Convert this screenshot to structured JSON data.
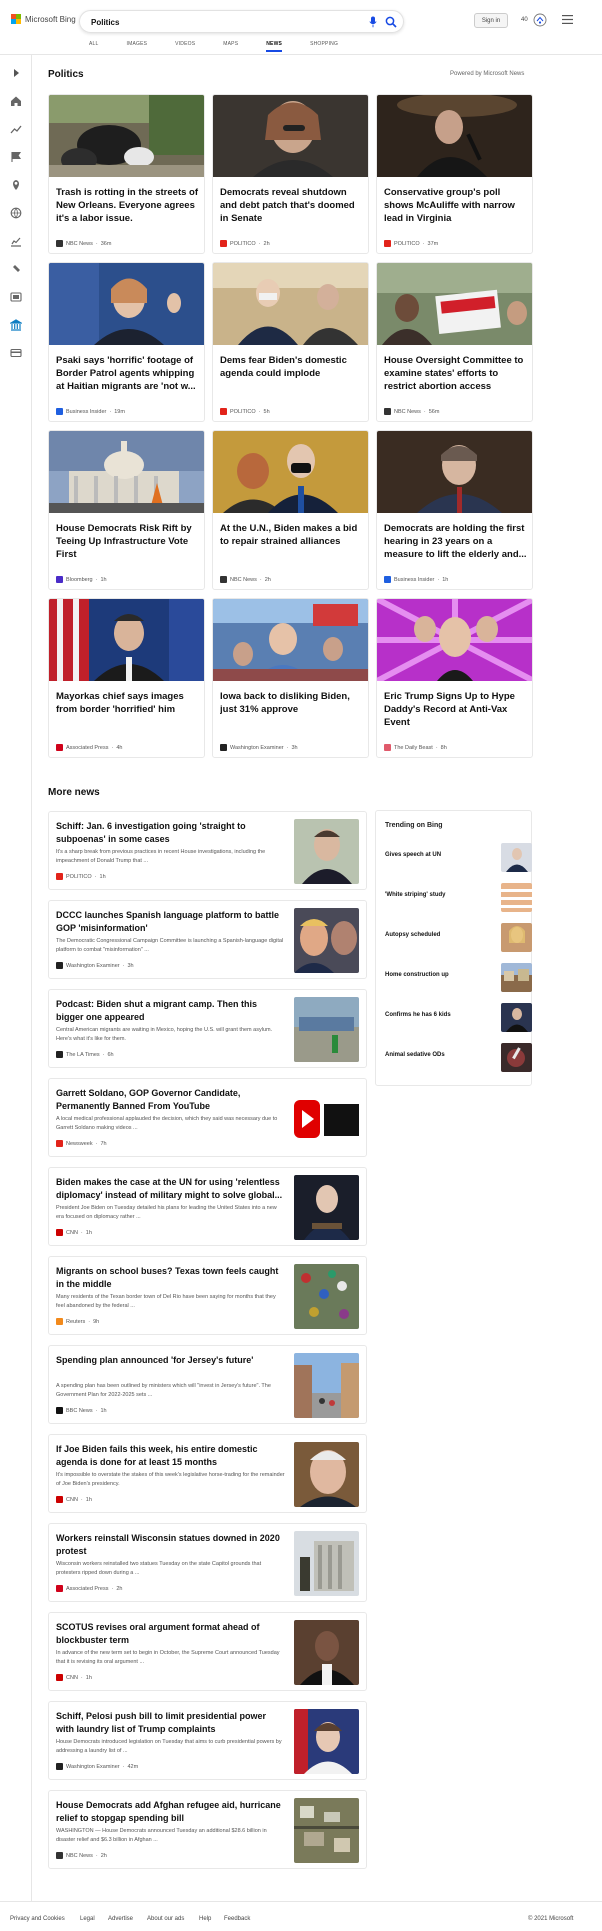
{
  "header": {
    "brand": "Microsoft Bing",
    "search_value": "Politics",
    "tabs": [
      {
        "label": "ALL"
      },
      {
        "label": "IMAGES"
      },
      {
        "label": "VIDEOS"
      },
      {
        "label": "MAPS"
      },
      {
        "label": "NEWS",
        "active": true
      },
      {
        "label": "SHOPPING"
      }
    ],
    "sign_in": "Sign in",
    "points": "40",
    "accent": "#174ae4"
  },
  "rail": {
    "icons": [
      "chevron-right-icon",
      "home-icon",
      "trending-icon",
      "flag-icon",
      "location-icon",
      "globe-icon",
      "finance-icon",
      "sports-icon",
      "entertainment-icon",
      "politics-icon",
      "technology-icon"
    ]
  },
  "politics": {
    "title": "Politics",
    "powered_by": "Powered by Microsoft News",
    "cards": [
      {
        "title": "Trash is rotting in the streets of New Orleans. Everyone agrees it's a labor issue.",
        "source": "NBC News",
        "time": "36m",
        "logo": "#333333"
      },
      {
        "title": "Democrats reveal shutdown and debt patch that's doomed in Senate",
        "source": "POLITICO",
        "time": "2h",
        "logo": "#e2231a"
      },
      {
        "title": "Conservative group's poll shows McAuliffe with narrow lead in Virginia",
        "source": "POLITICO",
        "time": "37m",
        "logo": "#e2231a"
      },
      {
        "title": "Psaki says 'horrific' footage of Border Patrol agents whipping at Haitian migrants are 'not w...",
        "source": "Business Insider",
        "time": "19m",
        "logo": "#1f5fe0"
      },
      {
        "title": "Dems fear Biden's domestic agenda could implode",
        "source": "POLITICO",
        "time": "5h",
        "logo": "#e2231a"
      },
      {
        "title": "House Oversight Committee to examine states' efforts to restrict abortion access",
        "source": "NBC News",
        "time": "56m",
        "logo": "#333333"
      },
      {
        "title": "House Democrats Risk Rift by Teeing Up Infrastructure Vote First",
        "source": "Bloomberg",
        "time": "1h",
        "logo": "#4a2cc8"
      },
      {
        "title": "At the U.N., Biden makes a bid to repair strained alliances",
        "source": "NBC News",
        "time": "2h",
        "logo": "#333333"
      },
      {
        "title": "Democrats are holding the first hearing in 23 years on a measure to lift the elderly and...",
        "source": "Business Insider",
        "time": "1h",
        "logo": "#1f5fe0"
      },
      {
        "title": "Mayorkas chief says images from border 'horrified' him",
        "source": "Associated Press",
        "time": "4h",
        "logo": "#d0021b"
      },
      {
        "title": "Iowa back to disliking Biden, just 31% approve",
        "source": "Washington Examiner",
        "time": "3h",
        "logo": "#222222"
      },
      {
        "title": "Eric Trump Signs Up to Hype Daddy's Record at Anti-Vax Event",
        "source": "The Daily Beast",
        "time": "8h",
        "logo": "#e05a6b"
      }
    ]
  },
  "more_news": {
    "title": "More news",
    "items": [
      {
        "title": "Schiff: Jan. 6 investigation going 'straight to subpoenas' in some cases",
        "snippet": "It's a sharp break from previous practices in recent House investigations, including the impeachment of Donald Trump that ...",
        "source": "POLITICO",
        "time": "1h",
        "logo": "#e2231a"
      },
      {
        "title": "DCCC launches Spanish language platform to battle GOP 'misinformation'",
        "snippet": "The Democratic Congressional Campaign Committee is launching a Spanish-language digital platform to combat \"misinformation\" ...",
        "source": "Washington Examiner",
        "time": "3h",
        "logo": "#222222"
      },
      {
        "title": "Podcast: Biden shut a migrant camp. Then this bigger one appeared",
        "snippet": "Central American migrants are waiting in Mexico, hoping the U.S. will grant them asylum. Here's what it's like for them.",
        "source": "The LA Times",
        "time": "6h",
        "logo": "#222222"
      },
      {
        "title": "Garrett Soldano, GOP Governor Candidate, Permanently Banned From YouTube",
        "snippet": "A local medical professional applauded the decision, which they said was necessary due to Garrett Soldano making videos ...",
        "source": "Newsweek",
        "time": "7h",
        "logo": "#e2231a"
      },
      {
        "title": "Biden makes the case at the UN for using 'relentless diplomacy' instead of military might to solve global...",
        "snippet": "President Joe Biden on Tuesday detailed his plans for leading the United States into a new era focused on diplomacy rather ...",
        "source": "CNN",
        "time": "1h",
        "logo": "#cc0000"
      },
      {
        "title": "Migrants on school buses? Texas town feels caught in the middle",
        "snippet": "Many residents of the Texan border town of Del Rio have been saying for months that they feel abandoned by the federal ...",
        "source": "Reuters",
        "time": "9h",
        "logo": "#f28a1c"
      },
      {
        "title": "Spending plan announced 'for Jersey's future'",
        "snippet": "A spending plan has been outlined by ministers which will \"invest in Jersey's future\". The Government Plan for 2022-2025 sets ...",
        "source": "BBC News",
        "time": "1h",
        "logo": "#111111"
      },
      {
        "title": "If Joe Biden fails this week, his entire domestic agenda is done for at least 15 months",
        "snippet": "It's impossible to overstate the stakes of this week's legislative horse-trading for the remainder of Joe Biden's presidency.",
        "source": "CNN",
        "time": "1h",
        "logo": "#cc0000"
      },
      {
        "title": "Workers reinstall Wisconsin statues downed in 2020 protest",
        "snippet": "Wisconsin workers reinstalled two statues Tuesday on the state Capitol grounds that protesters ripped down during a ...",
        "source": "Associated Press",
        "time": "2h",
        "logo": "#d0021b"
      },
      {
        "title": "SCOTUS revises oral argument format ahead of blockbuster term",
        "snippet": "In advance of the new term set to begin in October, the Supreme Court announced Tuesday that it is revising its oral argument ...",
        "source": "CNN",
        "time": "1h",
        "logo": "#cc0000"
      },
      {
        "title": "Schiff, Pelosi push bill to limit presidential power with laundry list of Trump complaints",
        "snippet": "House Democrats introduced legislation on Tuesday that aims to curb presidential powers by addressing a laundry list of ...",
        "source": "Washington Examiner",
        "time": "42m",
        "logo": "#222222"
      },
      {
        "title": "House Democrats add Afghan refugee aid, hurricane relief to stopgap spending bill",
        "snippet": "WASHINGTON — House Democrats announced Tuesday an additional $28.6 billion in disaster relief and $6.3 billion in Afghan ...",
        "source": "NBC News",
        "time": "2h",
        "logo": "#333333"
      }
    ]
  },
  "trending": {
    "title": "Trending on Bing",
    "items": [
      {
        "label": "Gives speech at UN"
      },
      {
        "label": "'White striping' study"
      },
      {
        "label": "Autopsy scheduled"
      },
      {
        "label": "Home construction up"
      },
      {
        "label": "Confirms he has 6 kids"
      },
      {
        "label": "Animal sedative ODs"
      }
    ]
  },
  "footer": {
    "links": [
      "Privacy and Cookies",
      "Legal",
      "Advertise",
      "About our ads",
      "Help",
      "Feedback"
    ],
    "copyright": "© 2021 Microsoft"
  }
}
